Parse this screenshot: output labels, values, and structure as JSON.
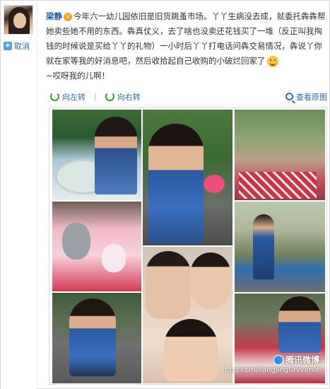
{
  "user": {
    "name": "梁静",
    "unfollow_label": "取消"
  },
  "post": {
    "text": "今年六一幼儿园依旧是旧货跳蚤市场。丫丫生病没去成，就委托犇犇帮她卖些她不用的东西。犇真仗义，去了啥也没卖还花钱买了一堆（反正叫我掏钱的时候说是买给丫丫的礼物）一小时后丫丫打电话问犇交易情况，犇说丫你就在家等我的好消息吧，然后收拾起自己收购的小破烂回家了",
    "text_tail": "~哎呀我的儿啊！"
  },
  "toolbar": {
    "rotate_left": "向左转",
    "rotate_right": "向右转",
    "view_original": "查看原图"
  },
  "watermark": {
    "brand": "腾讯微博",
    "url": "t.qq.com/liangjingUniverse"
  },
  "icons": {
    "avatar": "avatar-photo",
    "vip": "vip-badge-icon",
    "emoji": "laughing-emoji-icon",
    "rotate": "rotate-icon",
    "magnifier": "magnifier-icon"
  }
}
